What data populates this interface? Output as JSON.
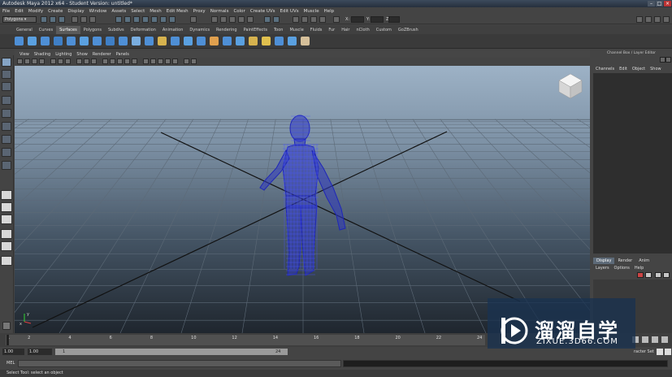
{
  "window": {
    "title": "Autodesk Maya 2012 x64 - Student Version: untitled*"
  },
  "menubar": [
    "File",
    "Edit",
    "Modify",
    "Create",
    "Display",
    "Window",
    "Assets",
    "Select",
    "Mesh",
    "Edit Mesh",
    "Proxy",
    "Normals",
    "Color",
    "Create UVs",
    "Edit UVs",
    "Muscle",
    "Help"
  ],
  "statusline": {
    "mode": "Polygons",
    "x_label": "X:",
    "y_label": "Y:",
    "z_label": "Z:"
  },
  "shelf_tabs": [
    "General",
    "Curves",
    "Surfaces",
    "Polygons",
    "Subdivs",
    "Deformation",
    "Animation",
    "Dynamics",
    "Rendering",
    "PaintEffects",
    "Toon",
    "Muscle",
    "Fluids",
    "Fur",
    "Hair",
    "nCloth",
    "Custom",
    "GoZBrush"
  ],
  "active_shelf_tab": "Surfaces",
  "panel_menu": [
    "View",
    "Shading",
    "Lighting",
    "Show",
    "Renderer",
    "Panels"
  ],
  "channel_box": {
    "header": "Channel Box / Layer Editor",
    "menu": [
      "Channels",
      "Edit",
      "Object",
      "Show"
    ]
  },
  "layer_editor": {
    "tabs": [
      "Display",
      "Render",
      "Anim"
    ],
    "active_tab": "Display",
    "menu": [
      "Layers",
      "Options",
      "Help"
    ]
  },
  "viewport": {
    "axis_x": "x",
    "axis_y": "y"
  },
  "time_slider": {
    "ticks": [
      "1",
      "2",
      "4",
      "6",
      "8",
      "10",
      "12",
      "14",
      "16",
      "18",
      "20",
      "22",
      "24"
    ]
  },
  "range": {
    "start": "1.00",
    "current": "1.00",
    "frame_start": "1",
    "frame_end": "24",
    "char_set": "racter Set"
  },
  "command_line": {
    "label": "MEL"
  },
  "help_line": {
    "text": "Select Tool: select an object"
  },
  "watermark": {
    "cn": "溜溜自学",
    "url": "ZIXUE.3D66.COM"
  },
  "colors": {
    "wireframe": "#2a32c8",
    "selected_shelf": "#5a5a5a",
    "viewport_top": "#9db2c6",
    "viewport_bottom": "#1f262e"
  }
}
